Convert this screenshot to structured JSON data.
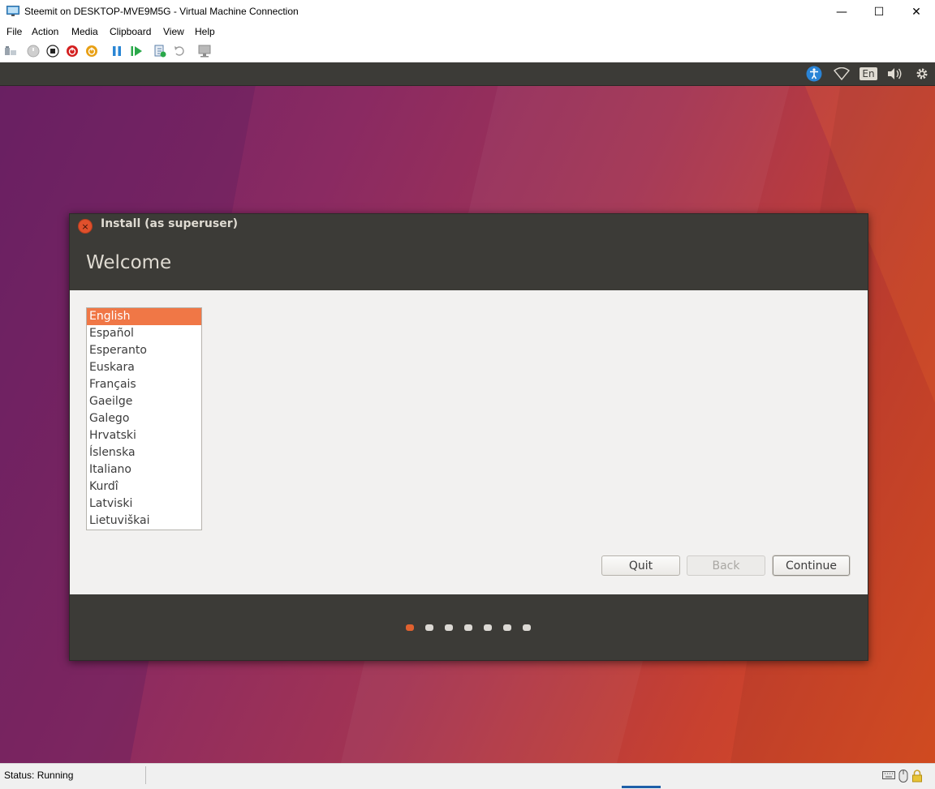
{
  "window": {
    "title": "Steemit on DESKTOP-MVE9M5G - Virtual Machine Connection",
    "controls": {
      "minimize": "—",
      "maximize": "☐",
      "close": "✕"
    }
  },
  "menu": [
    "File",
    "Action",
    "Media",
    "Clipboard",
    "View",
    "Help"
  ],
  "toolbar_icons": [
    "ctrl-alt-del-icon",
    "start-icon",
    "turn-off-icon",
    "shut-down-icon",
    "save-icon",
    "pause-icon",
    "reset-icon",
    "checkpoint-icon",
    "revert-icon",
    "enhanced-session-icon"
  ],
  "guest_topbar": {
    "indicators": [
      "accessibility-icon",
      "network-icon",
      "keyboard-layout-indicator",
      "volume-icon",
      "system-gear-icon"
    ],
    "keyboard_layout": "En"
  },
  "installer": {
    "window_title": "Install (as superuser)",
    "heading": "Welcome",
    "languages": [
      "English",
      "Español",
      "Esperanto",
      "Euskara",
      "Français",
      "Gaeilge",
      "Galego",
      "Hrvatski",
      "Íslenska",
      "Italiano",
      "Kurdî",
      "Latviski",
      "Lietuviškai"
    ],
    "selected_language": "English",
    "buttons": {
      "quit": "Quit",
      "back": "Back",
      "continue": "Continue"
    },
    "progress": {
      "step": 1,
      "total_steps": 7
    }
  },
  "status": {
    "text": "Status: Running"
  },
  "colors": {
    "accent": "#E95420",
    "selection": "#F07746",
    "panel_dark": "#3C3B37",
    "dialog_bg": "#F2F1F0"
  }
}
